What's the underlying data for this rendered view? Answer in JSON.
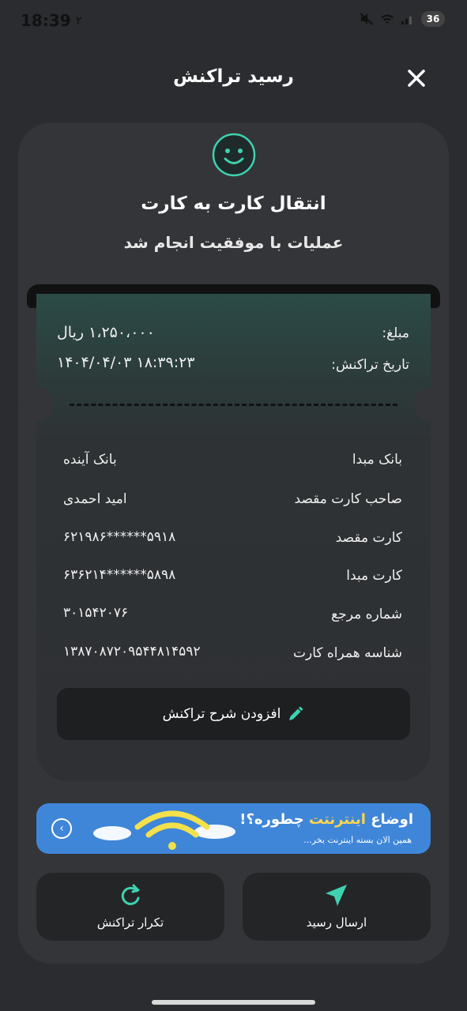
{
  "status": {
    "time": "18:39",
    "secondary": "۲",
    "battery": "36"
  },
  "header": {
    "title": "رسید تراکنش"
  },
  "summary": {
    "title": "انتقال کارت به کارت",
    "message": "عملیات با موفقیت انجام شد"
  },
  "receipt": {
    "amount_label": "مبلغ:",
    "amount_value": "۱،۲۵۰،۰۰۰ ریال",
    "date_label": "تاریخ تراکنش:",
    "date_value": "۱۴۰۴/۰۴/۰۳ ۱۸:۳۹:۲۳",
    "rows": [
      {
        "label": "بانک مبدا",
        "value": "بانک آینده"
      },
      {
        "label": "صاحب کارت مقصد",
        "value": "امید احمدی"
      },
      {
        "label": "کارت مقصد",
        "value": "۶۲۱۹۸۶******۵۹۱۸"
      },
      {
        "label": "کارت مبدا",
        "value": "۶۳۶۲۱۴******۵۸۹۸"
      },
      {
        "label": "شماره مرجع",
        "value": "۳۰۱۵۴۲۰۷۶"
      },
      {
        "label": "شناسه همراه کارت",
        "value": "۱۳۸۷۰۸۷۲۰۹۵۴۴۸۱۴۵۹۲"
      }
    ],
    "add_description": "افزودن شرح تراکنش"
  },
  "banner": {
    "title_pre": "اوضاع ",
    "title_highlight": "اینترنتت",
    "title_post": " چطوره؟!",
    "subtitle": "همین الان بسته اینترنت بخر..."
  },
  "actions": {
    "send_receipt": "ارسال رسید",
    "repeat": "تکرار تراکنش"
  },
  "colors": {
    "accent": "#3fd1b0",
    "banner": "#3f86d8",
    "card": "#343539",
    "background": "#2b2c2f"
  }
}
